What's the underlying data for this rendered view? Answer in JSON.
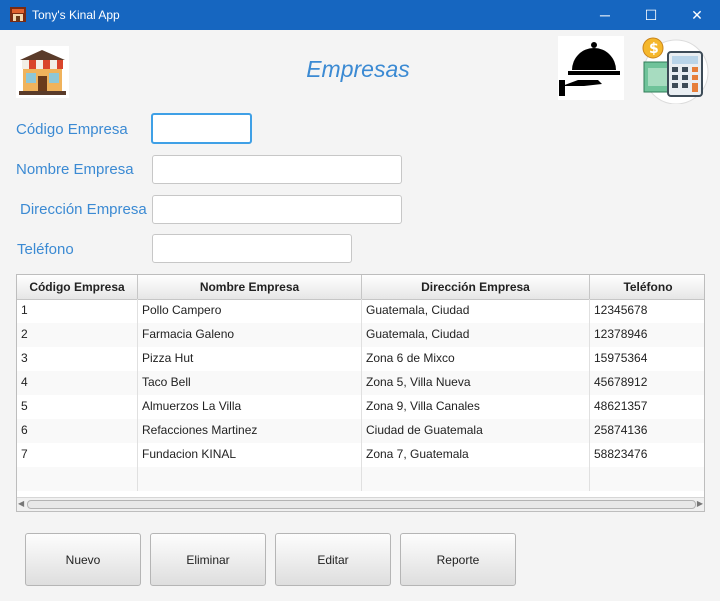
{
  "window": {
    "title": "Tony's Kinal App",
    "controls": {
      "minimize": "─",
      "maximize": "☐",
      "close": "✕"
    }
  },
  "header": {
    "title": "Empresas",
    "logo_icon": "restaurant-building-icon",
    "service_icon": "cloche-hand-icon",
    "calculator_icon": "calculator-money-icon"
  },
  "form": {
    "codigo_label": "Código Empresa",
    "codigo_value": "",
    "nombre_label": "Nombre Empresa",
    "nombre_value": "",
    "direccion_label": "Dirección Empresa",
    "direccion_value": "",
    "telefono_label": "Teléfono",
    "telefono_value": ""
  },
  "table": {
    "columns": [
      "Código Empresa",
      "Nombre Empresa",
      "Dirección Empresa",
      "Teléfono"
    ],
    "rows": [
      [
        "1",
        "Pollo Campero",
        "Guatemala, Ciudad",
        "12345678"
      ],
      [
        "2",
        "Farmacia Galeno",
        "Guatemala, Ciudad",
        "12378946"
      ],
      [
        "3",
        "Pizza Hut",
        "Zona 6 de Mixco",
        "15975364"
      ],
      [
        "4",
        "Taco Bell",
        "Zona 5, Villa Nueva",
        "45678912"
      ],
      [
        "5",
        "Almuerzos La Villa",
        "Zona 9, Villa Canales",
        "48621357"
      ],
      [
        "6",
        "Refacciones Martinez",
        "Ciudad de Guatemala",
        "25874136"
      ],
      [
        "7",
        "Fundacion KINAL",
        "Zona 7, Guatemala",
        "58823476"
      ]
    ]
  },
  "buttons": {
    "nuevo": "Nuevo",
    "eliminar": "Eliminar",
    "editar": "Editar",
    "reporte": "Reporte"
  },
  "colors": {
    "titlebar": "#1666c0",
    "accent": "#3b8ad3"
  }
}
